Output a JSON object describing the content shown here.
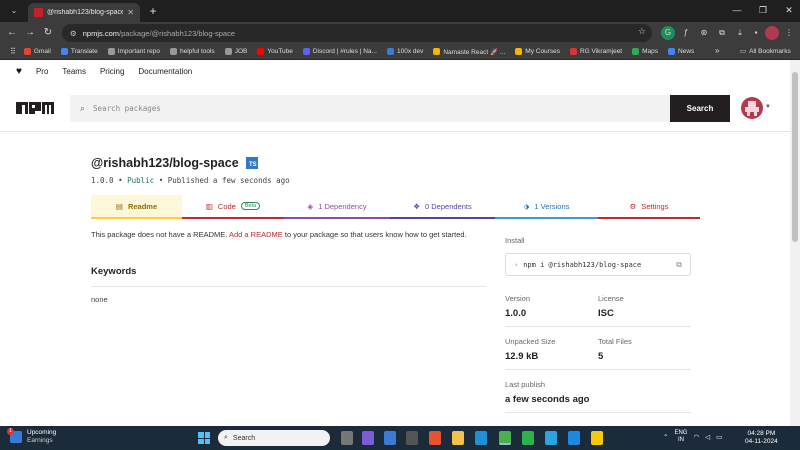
{
  "browser": {
    "tab_title": "@rishabh123/blog-space - npm",
    "url_domain": "npmjs.com",
    "url_path": "/package/@rishabh123/blog-space"
  },
  "bookmarks": {
    "items": [
      {
        "label": "Gmail",
        "color": "#ea4335"
      },
      {
        "label": "Translate",
        "color": "#4285f4"
      },
      {
        "label": "Important repo",
        "color": "#999999"
      },
      {
        "label": "helpful tools",
        "color": "#999999"
      },
      {
        "label": "JOB",
        "color": "#999999"
      },
      {
        "label": "YouTube",
        "color": "#ff0000"
      },
      {
        "label": "Discord | #rules | Na...",
        "color": "#5865f2"
      },
      {
        "label": "100x dev",
        "color": "#3a7bd5"
      },
      {
        "label": "Namaste React 🚀 ...",
        "color": "#f7b500"
      },
      {
        "label": "My Courses",
        "color": "#f7b500"
      },
      {
        "label": "RG Vikramjeet",
        "color": "#d33"
      },
      {
        "label": "Maps",
        "color": "#34a853"
      },
      {
        "label": "News",
        "color": "#4285f4"
      }
    ],
    "more": "»",
    "all_label": "All Bookmarks"
  },
  "topnav": {
    "items": [
      "Pro",
      "Teams",
      "Pricing",
      "Documentation"
    ]
  },
  "search": {
    "placeholder": "Search packages",
    "button_label": "Search"
  },
  "package": {
    "name": "@rishabh123/blog-space",
    "ts_badge": "TS",
    "version": "1.0.0",
    "sep": "•",
    "visibility": "Public",
    "published": "Published a few seconds ago"
  },
  "tabs": {
    "readme": "Readme",
    "code": "Code",
    "beta": "Beta",
    "dependency": "1 Dependency",
    "dependents": "0 Dependents",
    "versions": "1 Versions",
    "settings": "Settings"
  },
  "readme": {
    "msg_before": "This package does not have a README.",
    "link": "Add a README",
    "msg_after": "to your package so that users know how to get started."
  },
  "keywords": {
    "heading": "Keywords",
    "value": "none"
  },
  "sidebar": {
    "install_label": "Install",
    "install_cmd": "npm i @rishabh123/blog-space",
    "version_label": "Version",
    "version_value": "1.0.0",
    "license_label": "License",
    "license_value": "ISC",
    "unpacked_label": "Unpacked Size",
    "unpacked_value": "12.9 kB",
    "files_label": "Total Files",
    "files_value": "5",
    "publish_label": "Last publish",
    "publish_value": "a few seconds ago"
  },
  "taskbar": {
    "weather_badge": "1",
    "weather_title": "Upcoming",
    "weather_sub": "Earnings",
    "search_label": "Search",
    "lang_1": "ENG",
    "lang_2": "IN",
    "time": "04:28 PM",
    "date": "04-11-2024"
  }
}
